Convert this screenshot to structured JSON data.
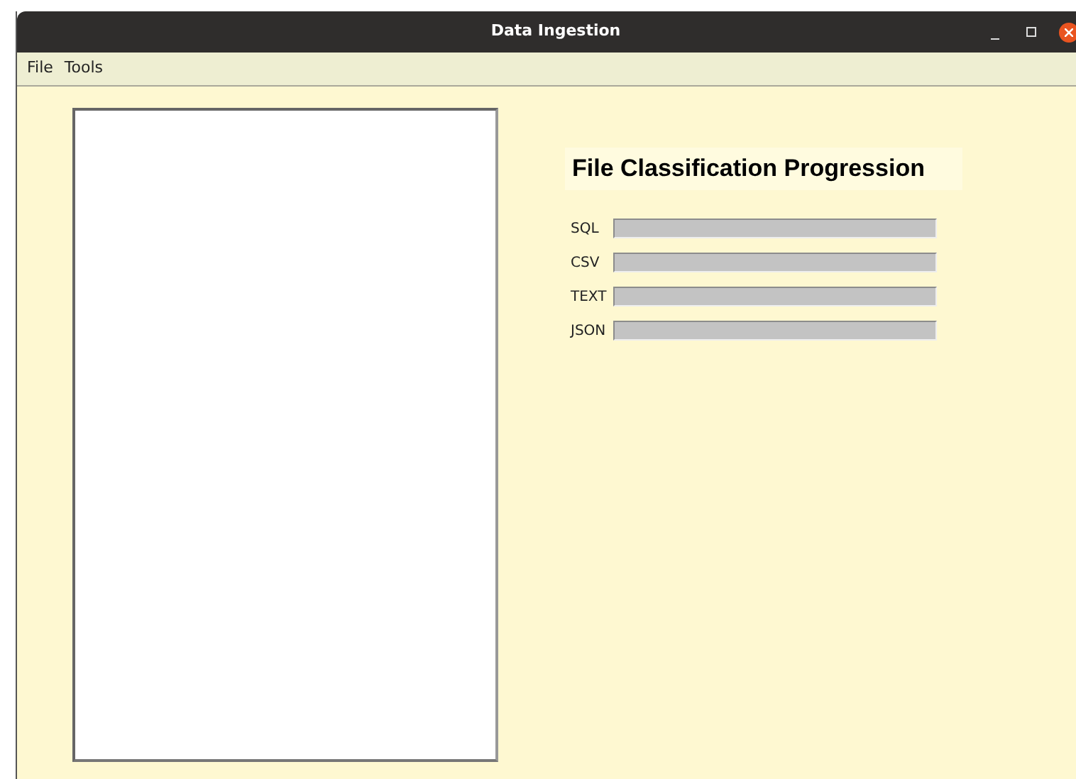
{
  "window": {
    "title": "Data Ingestion"
  },
  "menu": [
    "File",
    "Tools"
  ],
  "heading": "File Classification Progression",
  "progress": [
    {
      "label": "SQL",
      "level": 0
    },
    {
      "label": "CSV",
      "level": 0
    },
    {
      "label": "TEXT",
      "level": 0
    },
    {
      "label": "JSON",
      "level": 0
    }
  ]
}
